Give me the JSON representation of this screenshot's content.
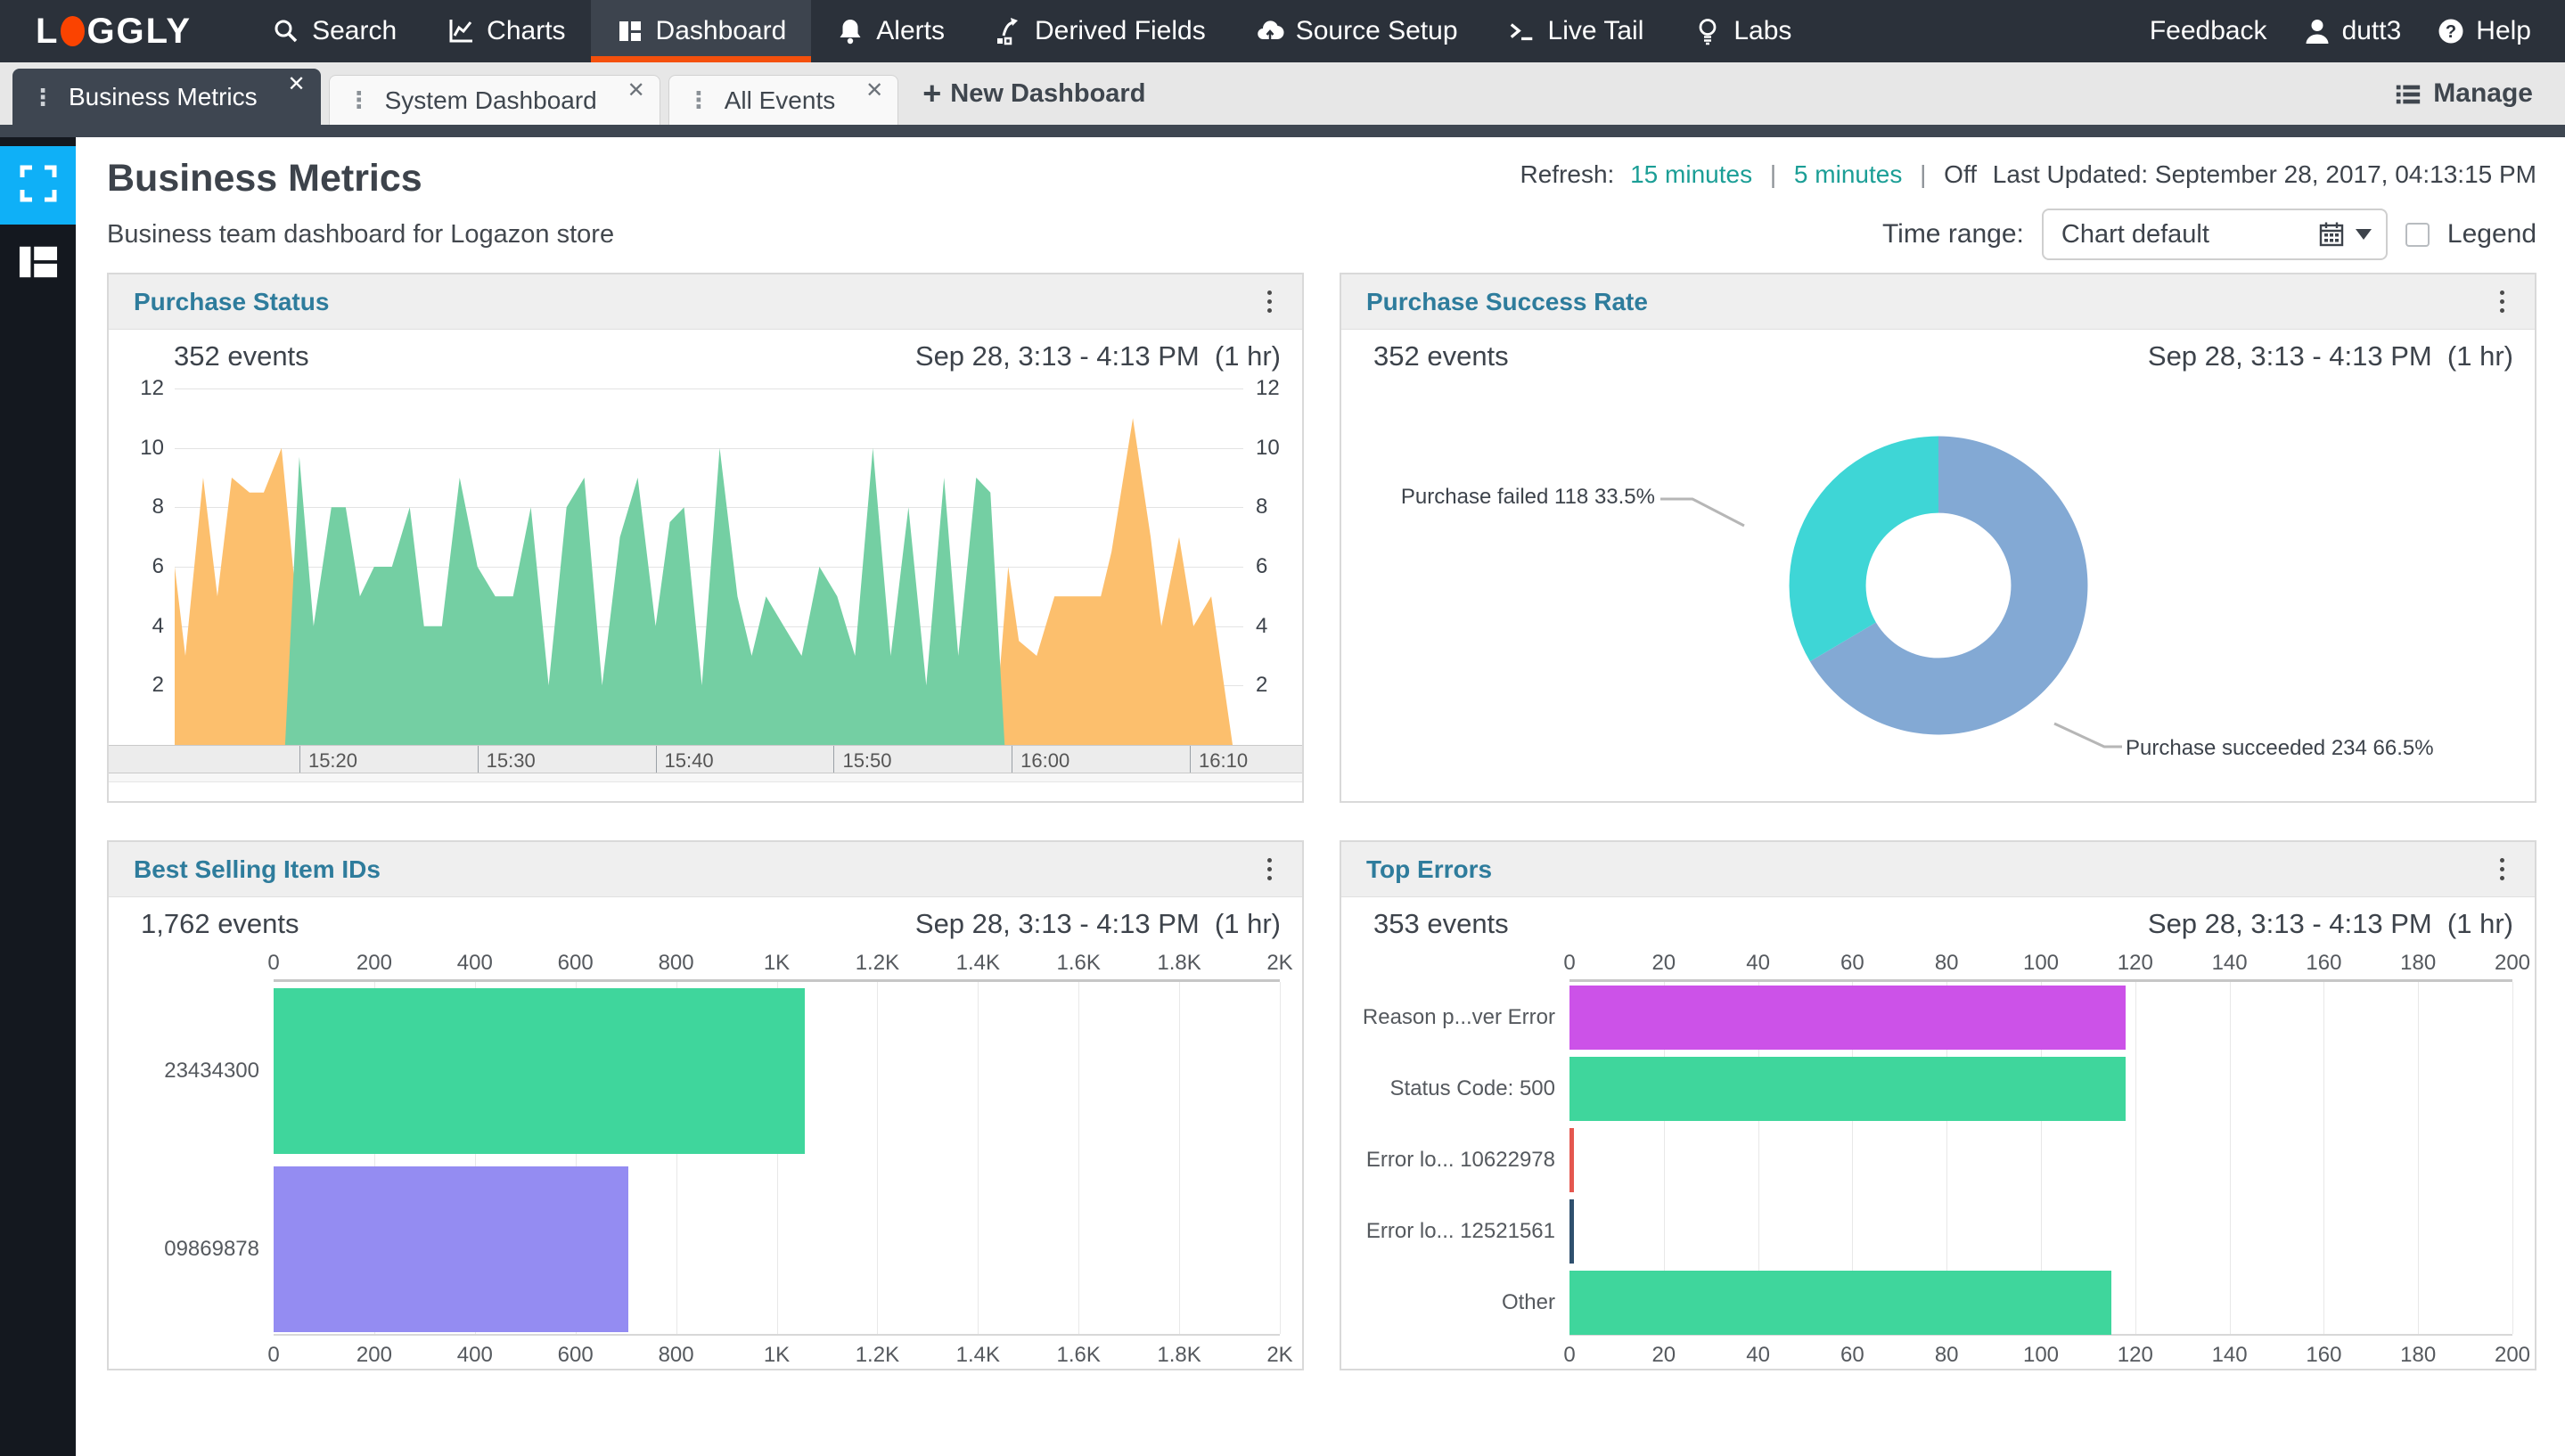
{
  "nav": {
    "logo_start": "L",
    "logo_end": "GGLY",
    "items": [
      {
        "id": "search",
        "label": "Search",
        "icon": "search-icon",
        "active": false
      },
      {
        "id": "charts",
        "label": "Charts",
        "icon": "charts-icon",
        "active": false
      },
      {
        "id": "dashboard",
        "label": "Dashboard",
        "icon": "dashboard-icon",
        "active": true
      },
      {
        "id": "alerts",
        "label": "Alerts",
        "icon": "alerts-icon",
        "active": false
      },
      {
        "id": "derived-fields",
        "label": "Derived Fields",
        "icon": "derived-fields-icon",
        "active": false
      },
      {
        "id": "source-setup",
        "label": "Source Setup",
        "icon": "source-setup-icon",
        "active": false
      },
      {
        "id": "live-tail",
        "label": "Live Tail",
        "icon": "live-tail-icon",
        "active": false
      },
      {
        "id": "labs",
        "label": "Labs",
        "icon": "labs-icon",
        "active": false
      }
    ],
    "feedback_label": "Feedback",
    "username": "dutt3",
    "help_label": "Help"
  },
  "tabs": {
    "items": [
      {
        "label": "Business Metrics",
        "active": true
      },
      {
        "label": "System Dashboard",
        "active": false
      },
      {
        "label": "All Events",
        "active": false
      }
    ],
    "new_dashboard_label": "New Dashboard",
    "manage_label": "Manage"
  },
  "header": {
    "title": "Business Metrics",
    "subtitle": "Business team dashboard for Logazon store",
    "refresh_label": "Refresh:",
    "refresh_15": "15 minutes",
    "refresh_5": "5 minutes",
    "separator": "|",
    "refresh_off": "Off",
    "last_updated": "Last Updated: September 28, 2017, 04:13:15 PM",
    "time_range_label": "Time range:",
    "time_range_value": "Chart default",
    "legend_label": "Legend",
    "legend_checked": false
  },
  "panels": {
    "purchase_status": {
      "title": "Purchase Status",
      "events": "352 events",
      "time_range": "Sep 28, 3:13 - 4:13 PM  (1 hr)"
    },
    "purchase_success_rate": {
      "title": "Purchase Success Rate",
      "events": "352 events",
      "time_range": "Sep 28, 3:13 - 4:13 PM  (1 hr)"
    },
    "best_selling": {
      "title": "Best Selling Item IDs",
      "events": "1,762 events",
      "time_range": "Sep 28, 3:13 - 4:13 PM  (1 hr)"
    },
    "top_errors": {
      "title": "Top Errors",
      "events": "353 events",
      "time_range": "Sep 28, 3:13 - 4:13 PM  (1 hr)"
    }
  },
  "chart_data": [
    {
      "id": "purchase_status",
      "type": "area",
      "title": "Purchase Status",
      "x_start": "15:13",
      "x_end": "16:13",
      "x_total_minutes": 60,
      "x_ticks": [
        {
          "minute": 7,
          "label": "15:20"
        },
        {
          "minute": 17,
          "label": "15:30"
        },
        {
          "minute": 27,
          "label": "15:40"
        },
        {
          "minute": 37,
          "label": "15:50"
        },
        {
          "minute": 47,
          "label": "16:00"
        },
        {
          "minute": 57,
          "label": "16:10"
        }
      ],
      "ylim": [
        0,
        12
      ],
      "y_ticks": [
        2,
        4,
        6,
        8,
        10,
        12
      ],
      "grid": true,
      "series": [
        {
          "name": "series-orange",
          "color": "#fcbf6d",
          "points": [
            [
              0,
              6
            ],
            [
              0.6,
              3
            ],
            [
              1.6,
              9
            ],
            [
              2.4,
              5
            ],
            [
              3.2,
              9
            ],
            [
              4.2,
              8.5
            ],
            [
              5,
              8.5
            ],
            [
              6,
              10
            ],
            [
              6.8,
              5
            ],
            [
              7.6,
              0
            ],
            [
              46,
              0
            ],
            [
              46.8,
              6
            ],
            [
              47.4,
              3.5
            ],
            [
              48.4,
              3
            ],
            [
              49.4,
              5
            ],
            [
              50.4,
              5
            ],
            [
              52,
              5
            ],
            [
              52.6,
              6.5
            ],
            [
              53.8,
              11
            ],
            [
              54.8,
              7
            ],
            [
              55.4,
              4
            ],
            [
              56.4,
              7
            ],
            [
              57.2,
              4
            ],
            [
              58.2,
              5
            ],
            [
              59.4,
              0
            ],
            [
              60,
              0
            ]
          ]
        },
        {
          "name": "series-green",
          "color": "#74cfa3",
          "points": [
            [
              6.2,
              0
            ],
            [
              7,
              9.7
            ],
            [
              7.8,
              4
            ],
            [
              8.8,
              8
            ],
            [
              9.6,
              8
            ],
            [
              10.4,
              5
            ],
            [
              11.2,
              6
            ],
            [
              12.2,
              6
            ],
            [
              13.2,
              8
            ],
            [
              14,
              4
            ],
            [
              15,
              4
            ],
            [
              16,
              9
            ],
            [
              17,
              6
            ],
            [
              18,
              5
            ],
            [
              19,
              5
            ],
            [
              20,
              8
            ],
            [
              21,
              2
            ],
            [
              22,
              8
            ],
            [
              23,
              9
            ],
            [
              24,
              2
            ],
            [
              25,
              7
            ],
            [
              26,
              9
            ],
            [
              27,
              4
            ],
            [
              27.8,
              7.5
            ],
            [
              28.6,
              8
            ],
            [
              29.6,
              2
            ],
            [
              30.6,
              10
            ],
            [
              31.6,
              5
            ],
            [
              32.4,
              3
            ],
            [
              33.2,
              5
            ],
            [
              34.2,
              4
            ],
            [
              35.2,
              3
            ],
            [
              36.2,
              6
            ],
            [
              37.2,
              5
            ],
            [
              38.2,
              3
            ],
            [
              39.2,
              10
            ],
            [
              40.2,
              3
            ],
            [
              41.2,
              8
            ],
            [
              42.2,
              2
            ],
            [
              43.2,
              9
            ],
            [
              44,
              3
            ],
            [
              45,
              9
            ],
            [
              45.8,
              8.5
            ],
            [
              46.6,
              0
            ]
          ]
        }
      ]
    },
    {
      "id": "purchase_success_rate",
      "type": "pie",
      "donut": true,
      "title": "Purchase Success Rate",
      "total_events": 352,
      "start": "top",
      "direction": "clockwise",
      "slices": [
        {
          "label": "Purchase succeeded",
          "count": 234,
          "percent": 66.5,
          "color": "#83a9d4",
          "annotation": "Purchase succeeded 234 66.5%"
        },
        {
          "label": "Purchase failed",
          "count": 118,
          "percent": 33.5,
          "color": "#3ed6d6",
          "annotation": "Purchase failed 118 33.5%"
        }
      ]
    },
    {
      "id": "best_selling",
      "type": "bar",
      "orientation": "horizontal",
      "title": "Best Selling Item IDs",
      "categories": [
        "23434300",
        "09869878"
      ],
      "values": [
        1055,
        705
      ],
      "bar_colors": [
        "#3fd69c",
        "#948cf2"
      ],
      "xlim": [
        0,
        2000
      ],
      "x_ticks": [
        "0",
        "200",
        "400",
        "600",
        "800",
        "1K",
        "1.2K",
        "1.4K",
        "1.6K",
        "1.8K",
        "2K"
      ],
      "grid": true,
      "axis_position": "top_and_bottom"
    },
    {
      "id": "top_errors",
      "type": "bar",
      "orientation": "horizontal",
      "title": "Top Errors",
      "categories": [
        "Reason p...ver Error",
        "Status Code: 500",
        "Error lo... 10622978",
        "Error lo... 12521561",
        "Other"
      ],
      "values": [
        118,
        118,
        1,
        1,
        115
      ],
      "bar_colors": [
        "#cc52e8",
        "#3fd69c",
        "#e4574f",
        "#2f506e",
        "#3fd69c"
      ],
      "xlim": [
        0,
        200
      ],
      "x_ticks": [
        "0",
        "20",
        "40",
        "60",
        "80",
        "100",
        "120",
        "140",
        "160",
        "180",
        "200"
      ],
      "grid": true,
      "axis_position": "top_and_bottom"
    }
  ],
  "colors": {
    "nav_bg": "#2b313a",
    "nav_active_bg": "#3d444e",
    "accent_orange": "#f4500c",
    "logo_dot": "#fb4300",
    "tab_active_bg": "#3e4651",
    "sidebar_bg": "#14181f",
    "sidebar_active_blue": "#0fb0f7",
    "link_teal": "#1b9e96",
    "panel_title_teal": "#2e7c9c"
  }
}
